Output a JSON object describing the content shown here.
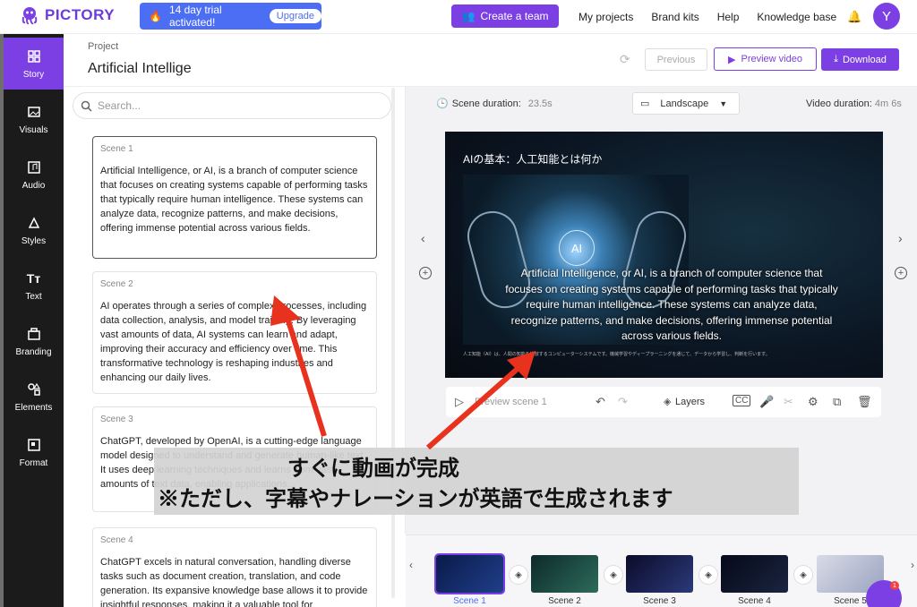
{
  "app": {
    "logo_text": "PICTORY",
    "brand_color": "#7b3fe4"
  },
  "trial": {
    "text": "14 day trial activated!",
    "upgrade": "Upgrade"
  },
  "header": {
    "create_team": "Create a team",
    "nav": [
      "My projects",
      "Brand kits",
      "Help",
      "Knowledge base"
    ],
    "avatar_letter": "Y"
  },
  "sidebar": {
    "items": [
      {
        "label": "Story",
        "icon": "story-icon",
        "active": true
      },
      {
        "label": "Visuals",
        "icon": "image-icon"
      },
      {
        "label": "Audio",
        "icon": "music-icon"
      },
      {
        "label": "Styles",
        "icon": "styles-icon"
      },
      {
        "label": "Text",
        "icon": "text-icon"
      },
      {
        "label": "Branding",
        "icon": "branding-icon"
      },
      {
        "label": "Elements",
        "icon": "elements-icon"
      },
      {
        "label": "Format",
        "icon": "format-icon"
      }
    ]
  },
  "project": {
    "label": "Project",
    "title": "Artificial Intellige"
  },
  "actions": {
    "previous": "Previous",
    "preview": "Preview video",
    "download": "Download"
  },
  "search": {
    "placeholder": "Search..."
  },
  "scenes": [
    {
      "label": "Scene 1",
      "text": "Artificial Intelligence, or AI, is a branch of computer science that focuses on creating systems capable of performing tasks that typically require human intelligence. These systems can analyze data, recognize patterns, and make decisions, offering immense potential across various fields."
    },
    {
      "label": "Scene 2",
      "text": "AI operates through a series of complex processes, including data collection, analysis, and model training. By leveraging vast amounts of data, AI systems can learn and adapt, improving their accuracy and efficiency over time. This transformative technology is reshaping industries and enhancing our daily lives."
    },
    {
      "label": "Scene 3",
      "text": "ChatGPT, developed by OpenAI, is a cutting-edge language model designed to understand and generate human-like text. It uses deep learning techniques and learns from vast amounts of text data, enabling applications..."
    },
    {
      "label": "Scene 4",
      "text": "ChatGPT excels in natural conversation, handling diverse tasks such as document creation, translation, and code generation. Its expansive knowledge base allows it to provide insightful responses, making it a valuable tool for"
    }
  ],
  "editor": {
    "scene_duration_label": "Scene duration:",
    "scene_duration": "23.5s",
    "orientation": "Landscape",
    "video_duration_label": "Video duration:",
    "video_duration": "4m 6s"
  },
  "canvas": {
    "title": "AIの基本：人工知能とは何か",
    "ai_label": "AI",
    "caption": "Artificial Intelligence, or AI, is a branch of computer science that focuses on creating systems capable of performing tasks that typically require human intelligence. These systems can analyze data, recognize patterns, and make decisions, offering immense potential across various fields.",
    "small_caption": "人工知能（AI）は、人間の知能を模倣するコンピューターシステムです。機械学習やディープラーニングを通じて、データから学習し、判断を行います。"
  },
  "toolbar": {
    "preview_scene": "Preview scene 1",
    "layers": "Layers"
  },
  "annotation": {
    "line1": "すぐに動画が完成",
    "line2": "※ただし、字幕やナレーションが英語で生成されます"
  },
  "timeline": {
    "scenes": [
      "Scene 1",
      "Scene 2",
      "Scene 3",
      "Scene 4",
      "Scene 5"
    ]
  },
  "chat": {
    "badge": "1"
  },
  "colors": {
    "accent": "#7b3fe4",
    "trial_blue": "#4c6ef5",
    "arrow_red": "#e8321e"
  }
}
